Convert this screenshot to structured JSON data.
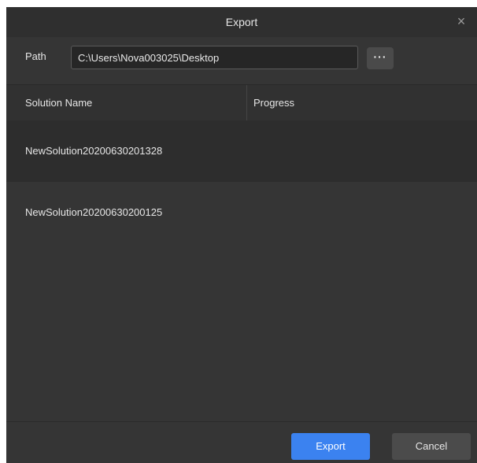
{
  "dialog": {
    "title": "Export",
    "close_glyph": "×",
    "close_icon": "close-icon"
  },
  "path": {
    "label": "Path",
    "value": "C:\\Users\\Nova003025\\Desktop",
    "browse_label": "···"
  },
  "table": {
    "columns": [
      "Solution Name",
      "Progress"
    ],
    "rows": [
      {
        "name": "NewSolution20200630201328",
        "progress": ""
      },
      {
        "name": "NewSolution20200630200125",
        "progress": ""
      }
    ]
  },
  "footer": {
    "export_label": "Export",
    "cancel_label": "Cancel"
  },
  "colors": {
    "accent": "#3b82f0",
    "background": "#353535",
    "selected_row": "#2d2d2d"
  }
}
